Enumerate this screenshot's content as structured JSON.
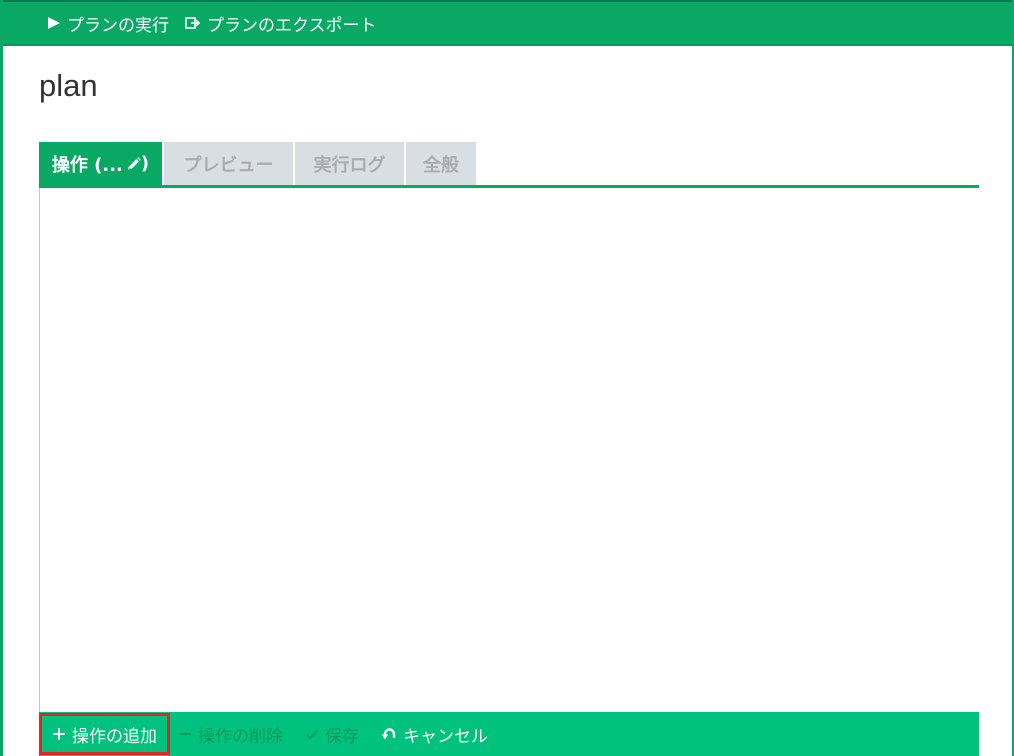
{
  "toolbar": {
    "run_label": "プランの実行",
    "export_label": "プランのエクスポート"
  },
  "page": {
    "title": "plan"
  },
  "tabs": [
    {
      "label": "操作 (...",
      "active": true
    },
    {
      "label": "プレビュー",
      "active": false
    },
    {
      "label": "実行ログ",
      "active": false
    },
    {
      "label": "全般",
      "active": false
    }
  ],
  "actions": {
    "add_label": "操作の追加",
    "delete_label": "操作の削除",
    "save_label": "保存",
    "cancel_label": "キャンセル"
  },
  "icons": {
    "run": "play-icon",
    "export": "export-icon",
    "edit": "pencil-icon",
    "add": "plus-icon",
    "delete": "minus-icon",
    "save": "check-icon",
    "cancel": "undo-icon"
  },
  "colors": {
    "accent": "#0aa865",
    "toolbar_bottom": "#00c27f",
    "tab_inactive": "#d9dee3",
    "highlight": "#e52525"
  }
}
